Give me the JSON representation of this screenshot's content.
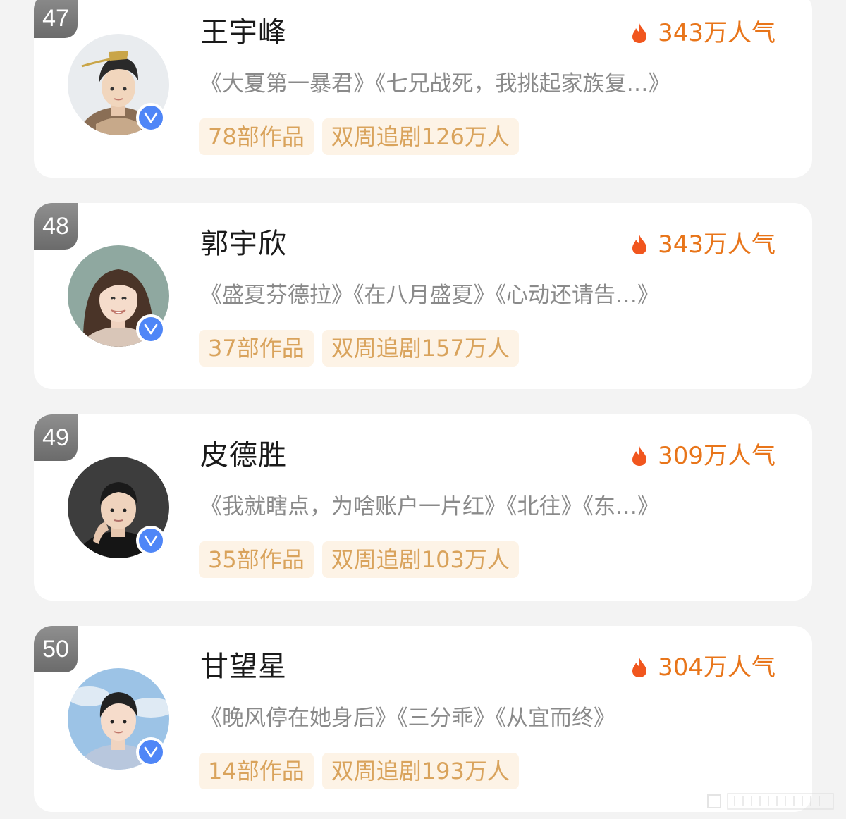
{
  "colors": {
    "background": "#f3f3f3",
    "card": "#ffffff",
    "accent_orange": "#e8751a",
    "tag_bg": "#fdf3e6",
    "tag_text": "#d9a35c",
    "verified_blue": "#4f86f7",
    "rank_badge_gray": "#7a7a7a"
  },
  "ranking": [
    {
      "rank": "47",
      "name": "王宇峰",
      "popularity": "343万人气",
      "works": "《大夏第一暴君》《七兄战死，我挑起家族复…》",
      "tag_works": "78部作品",
      "tag_fans": "双周追剧126万人",
      "verified": "V",
      "avatar_icon": "avatar-ancient-costume-photo"
    },
    {
      "rank": "48",
      "name": "郭宇欣",
      "popularity": "343万人气",
      "works": "《盛夏芬德拉》《在八月盛夏》《心动还请告…》",
      "tag_works": "37部作品",
      "tag_fans": "双周追剧157万人",
      "verified": "V",
      "avatar_icon": "avatar-smiling-woman-photo"
    },
    {
      "rank": "49",
      "name": "皮德胜",
      "popularity": "309万人气",
      "works": "《我就瞎点，为啥账户一片红》《北往》《东…》",
      "tag_works": "35部作品",
      "tag_fans": "双周追剧103万人",
      "verified": "V",
      "avatar_icon": "avatar-dark-suit-photo"
    },
    {
      "rank": "50",
      "name": "甘望星",
      "popularity": "304万人气",
      "works": "《晚风停在她身后》《三分乖》《从宜而终》",
      "tag_works": "14部作品",
      "tag_fans": "双周追剧193万人",
      "verified": "V",
      "avatar_icon": "avatar-sky-background-photo"
    }
  ]
}
